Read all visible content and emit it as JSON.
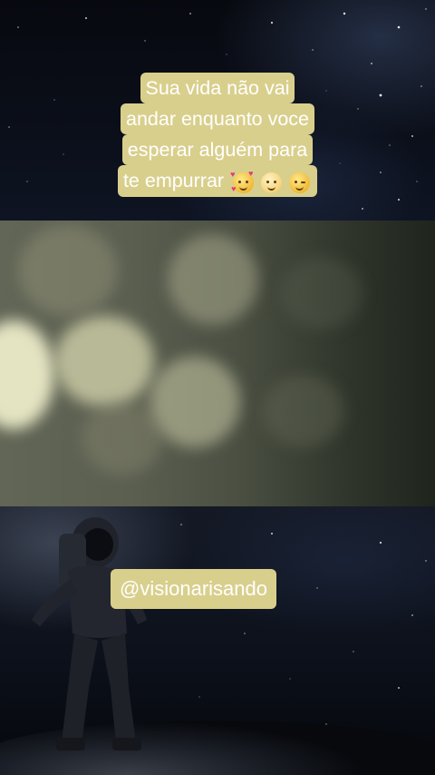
{
  "caption": {
    "lines": [
      "Sua vida não vai",
      "andar enquanto voce",
      "esperar alguém para",
      "te empurrar"
    ],
    "emojis": [
      "smiling-face-with-hearts-emoji",
      "face-with-bandage-emoji",
      "winking-face-emoji"
    ]
  },
  "handle": {
    "text": "@visionarisando"
  },
  "colors": {
    "caption_background": "#d9cf8c",
    "caption_text": "#ffffff",
    "space_dark": "#0b0f1a",
    "bokeh_tone": "#5b5f50"
  }
}
